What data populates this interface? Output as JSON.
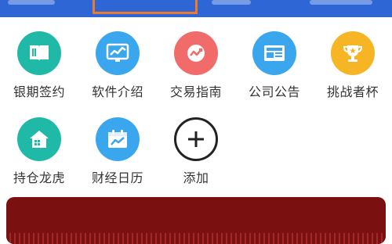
{
  "colors": {
    "topbar": "#2f66d6",
    "active_tab_border": "#f07a2a",
    "teal": "#20b9a8",
    "blue": "#3aa6ee",
    "red": "#f26b6b",
    "gold": "#f6b524",
    "banner": "#7a1010"
  },
  "grid": {
    "items": [
      {
        "label": "银期签约",
        "icon": "book-icon"
      },
      {
        "label": "软件介绍",
        "icon": "monitor-chart-icon"
      },
      {
        "label": "交易指南",
        "icon": "trend-arrow-icon"
      },
      {
        "label": "公司公告",
        "icon": "newspaper-icon"
      },
      {
        "label": "挑战者杯",
        "icon": "trophy-icon"
      },
      {
        "label": "持仓龙虎",
        "icon": "house-icon"
      },
      {
        "label": "财经日历",
        "icon": "calendar-chart-icon"
      },
      {
        "label": "添加",
        "icon": "plus-icon"
      }
    ]
  }
}
